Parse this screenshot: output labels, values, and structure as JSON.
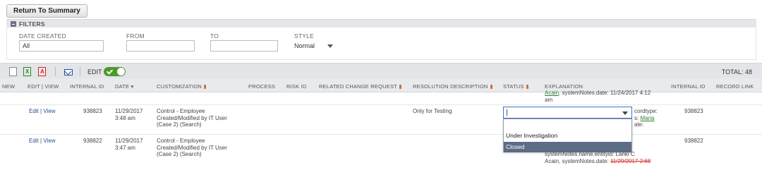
{
  "top": {
    "return_label": "Return To Summary"
  },
  "filters": {
    "title": "FILTERS",
    "date_created": {
      "label": "DATE CREATED",
      "value": "All"
    },
    "from": {
      "label": "FROM",
      "value": ""
    },
    "to": {
      "label": "TO",
      "value": ""
    },
    "style": {
      "label": "STYLE",
      "value": "Normal"
    }
  },
  "toolbar": {
    "edit_label": "EDIT",
    "total": "TOTAL: 48"
  },
  "columns": [
    "NEW",
    "EDIT | VIEW",
    "INTERNAL ID",
    "DATE",
    "CUSTOMIZATION",
    "PROCESS",
    "RISK ID",
    "RELATED CHANGE REQUEST",
    "RESOLUTION DESCRIPTION",
    "STATUS",
    "EXPLANATION",
    "INTERNAL ID",
    "RECORD LINK"
  ],
  "date_sort_arrow": "▾",
  "prev_row": {
    "explanation_line1_green": "Acain",
    "explanation_line1_rest": ", systemNotes.date: 11/24/2017 4:12",
    "explanation_line2": "am"
  },
  "rows": [
    {
      "edit": "Edit",
      "sep": "|",
      "view": "View",
      "internal_id": "938823",
      "date_line1": "11/29/2017",
      "date_line2": "3:48 am",
      "cust_line1": "Control - Employee",
      "cust_line2": "Created/Modified by IT User",
      "cust_line3": "(Case 2) (Search)",
      "resolution": "Only for Testing",
      "expl_line1": "cordtype:",
      "expl_line2_pre": "s: ",
      "expl_line2_link": "Maria",
      "expl_line3": "ate:",
      "internal_id2": "938823"
    },
    {
      "edit": "Edit",
      "sep": "|",
      "view": "View",
      "internal_id": "938822",
      "date_line1": "11/29/2017",
      "date_line2": "3:47 am",
      "cust_line1": "Control - Employee",
      "cust_line2": "Created/Modified by IT User",
      "cust_line3": "(Case 2) (Search)",
      "expl_line1": "systemNotes.name.entityid: Lanki C",
      "expl_line2": "Acain, systemNotes.date: ",
      "expl_line2_red": "11/29/2017 2:68",
      "internal_id2": "938822"
    }
  ],
  "status_dropdown": {
    "value": "",
    "options": [
      "",
      "Under Investigation",
      "Closed"
    ]
  },
  "colors": {
    "toggle_green": "#4c9a2a",
    "selected_option": "#5c6d85",
    "link": "#1d4f91"
  }
}
